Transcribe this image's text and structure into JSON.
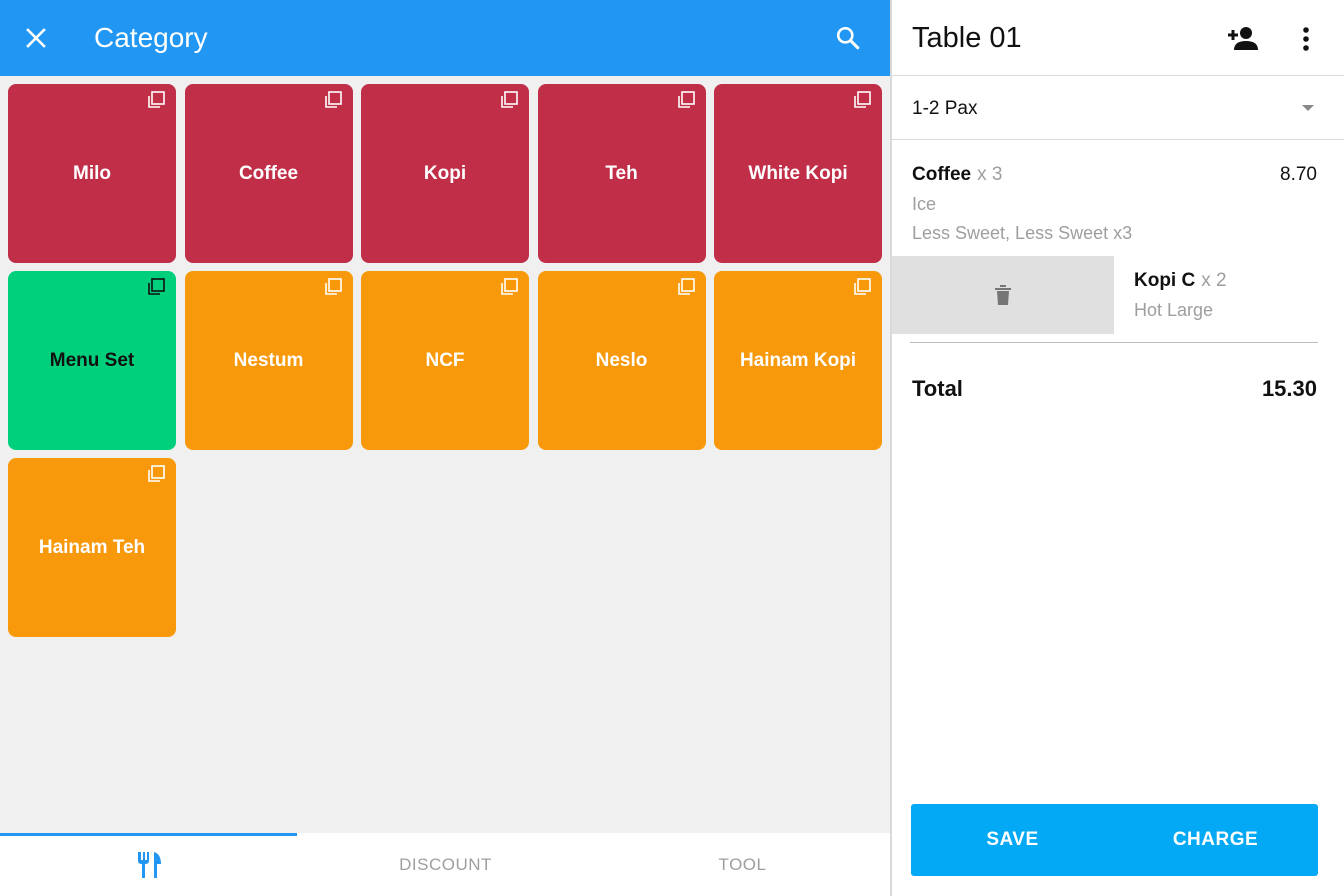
{
  "header": {
    "title": "Category",
    "close_icon": "close-icon",
    "search_icon": "search-icon"
  },
  "tiles": [
    {
      "label": "Milo",
      "color": "#c02e48",
      "text_color": "#ffffff"
    },
    {
      "label": "Coffee",
      "color": "#c02e48",
      "text_color": "#ffffff"
    },
    {
      "label": "Kopi",
      "color": "#c02e48",
      "text_color": "#ffffff"
    },
    {
      "label": "Teh",
      "color": "#c02e48",
      "text_color": "#ffffff"
    },
    {
      "label": "White Kopi",
      "color": "#c02e48",
      "text_color": "#ffffff"
    },
    {
      "label": "Menu Set",
      "color": "#00d07b",
      "text_color": "#111111"
    },
    {
      "label": "Nestum",
      "color": "#f8980b",
      "text_color": "#ffffff"
    },
    {
      "label": "NCF",
      "color": "#f8980b",
      "text_color": "#ffffff"
    },
    {
      "label": "Neslo",
      "color": "#f8980b",
      "text_color": "#ffffff"
    },
    {
      "label": "Hainam Kopi",
      "color": "#f8980b",
      "text_color": "#ffffff"
    },
    {
      "label": "Hainam Teh",
      "color": "#f8980b",
      "text_color": "#ffffff"
    }
  ],
  "bottom_nav": {
    "tabs": [
      {
        "icon": "utensils-icon",
        "label": "",
        "active": true
      },
      {
        "label": "DISCOUNT",
        "active": false
      },
      {
        "label": "TOOL",
        "active": false
      }
    ],
    "accent_color": "#2196f3"
  },
  "order": {
    "table_name": "Table 01",
    "add_person_icon": "add-person-icon",
    "more_icon": "more-vert-icon",
    "pax": "1-2 Pax",
    "items": [
      {
        "name": "Coffee",
        "qty": "x 3",
        "price": "8.70",
        "modifiers": [
          "Ice",
          "Less Sweet, Less Sweet x3"
        ]
      },
      {
        "name": "Kopi C",
        "qty": "x 2",
        "modifiers": [
          "Hot Large"
        ],
        "delete_icon": "trash-icon"
      }
    ],
    "total_label": "Total",
    "total_value": "15.30",
    "save_label": "SAVE",
    "charge_label": "CHARGE",
    "action_color": "#03a9f4"
  }
}
